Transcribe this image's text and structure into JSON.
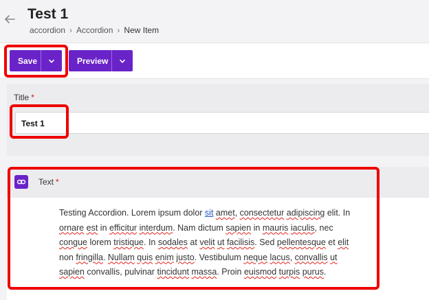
{
  "header": {
    "title": "Test 1",
    "breadcrumb": [
      "accordion",
      "Accordion",
      "New Item"
    ]
  },
  "toolbar": {
    "save_label": "Save",
    "preview_label": "Preview"
  },
  "fields": {
    "title": {
      "label": "Title",
      "required": "*",
      "value": "Test 1"
    },
    "text": {
      "label": "Text",
      "required": "*"
    }
  },
  "content": {
    "p1": "Testing Accordion. Lorem ipsum dolor ",
    "w_sit": "sit",
    "p2": " ",
    "w_amet": "amet",
    "p3": ", ",
    "w_consectetur": "consectetur",
    "p4": " ",
    "w_adipiscing": "adipiscing",
    "p5": " elit. In ",
    "w_ornare": "ornare",
    "p6": " ",
    "w_est": "est",
    "p7": " in ",
    "w_efficitur": "efficitur",
    "p8": " ",
    "w_interdum": "interdum",
    "p9": ". Nam dictum ",
    "w_sapien": "sapien",
    "p10": " in ",
    "w_mauris": "mauris",
    "p11": " ",
    "w_iaculis": "iaculis",
    "p12": ", nec ",
    "w_congue": "congue",
    "p13": " lorem ",
    "w_tristique": "tristique",
    "p14": ". In ",
    "w_sodales": "sodales",
    "p15": " at ",
    "w_velit": "velit",
    "p16": " ",
    "w_ut": "ut",
    "p17": " ",
    "w_facilisis": "facilisis",
    "p18": ". Sed ",
    "w_pellentesque": "pellentesque",
    "p19": " et ",
    "w_elit": "elit",
    "p20": " non ",
    "w_fringilla": "fringilla",
    "p21": ". ",
    "w_nullam": "Nullam",
    "p22": " ",
    "w_quis": "quis",
    "p23": " ",
    "w_enim": "enim",
    "p24": " ",
    "w_justo": "justo",
    "p25": ". Vestibulum ",
    "w_neque": "neque",
    "p26": " ",
    "w_lacus": "lacus",
    "p27": ", ",
    "w_convallis": "convallis",
    "p28": " ",
    "w_ut2": "ut",
    "p29": " ",
    "w_sapien2": "sapien",
    "p30": " convallis, pulvinar ",
    "w_tincidunt": "tincidunt",
    "p31": " ",
    "w_massa": "massa",
    "p32": ". Proin ",
    "w_euismod": "euismod",
    "p33": " ",
    "w_turpis": "turpis",
    "p34": " ",
    "w_purus": "purus",
    "p35": "."
  },
  "icons": {
    "back": "arrow-left-icon",
    "chevron": "chevron-down-icon",
    "text": "link-icon"
  },
  "colors": {
    "accent": "#6a23c8",
    "highlight": "#ee0000",
    "required": "#dd1111"
  }
}
